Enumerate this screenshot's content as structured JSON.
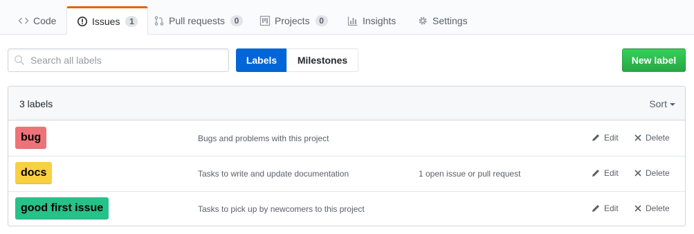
{
  "tabs": [
    {
      "label": "Code",
      "icon": "code-icon",
      "counter": null
    },
    {
      "label": "Issues",
      "icon": "issue-opened-icon",
      "counter": "1",
      "selected": true
    },
    {
      "label": "Pull requests",
      "icon": "git-pull-request-icon",
      "counter": "0"
    },
    {
      "label": "Projects",
      "icon": "project-icon",
      "counter": "0"
    },
    {
      "label": "Insights",
      "icon": "graph-icon",
      "counter": null
    },
    {
      "label": "Settings",
      "icon": "gear-icon",
      "counter": null
    }
  ],
  "search": {
    "placeholder": "Search all labels",
    "value": ""
  },
  "toggle": {
    "labels": "Labels",
    "milestones": "Milestones"
  },
  "new_label_button": "New label",
  "list": {
    "count_text": "3 labels",
    "sort_label": "Sort",
    "labels": [
      {
        "name": "bug",
        "color": "#ee7378",
        "description": "Bugs and problems with this project",
        "issues": "",
        "edit": "Edit",
        "delete": "Delete"
      },
      {
        "name": "docs",
        "color": "#f8d040",
        "description": "Tasks to write and update documentation",
        "issues": "1 open issue or pull request",
        "edit": "Edit",
        "delete": "Delete"
      },
      {
        "name": "good first issue",
        "color": "#27c289",
        "description": "Tasks to pick up by newcomers to this project",
        "issues": "",
        "edit": "Edit",
        "delete": "Delete"
      }
    ]
  },
  "colors": {
    "accent": "#0366d6",
    "selected_tab_border": "#e36209",
    "primary_button": "#28a745"
  }
}
